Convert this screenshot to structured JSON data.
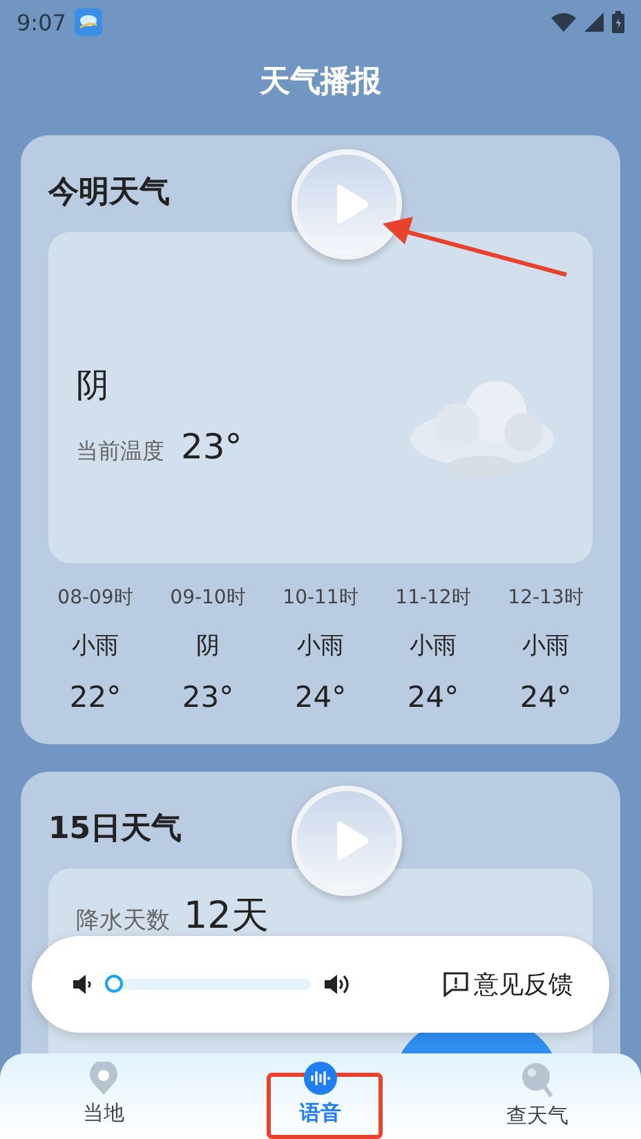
{
  "status_bar": {
    "time": "9:07"
  },
  "title": "天气播报",
  "cards": [
    {
      "kind": "today",
      "title": "今明天气",
      "condition": "阴",
      "temp_label": "当前温度",
      "temp": "23°",
      "hours": [
        {
          "time": "08-09时",
          "weather": "小雨",
          "temp": "22°"
        },
        {
          "time": "09-10时",
          "weather": "阴",
          "temp": "23°"
        },
        {
          "time": "10-11时",
          "weather": "小雨",
          "temp": "24°"
        },
        {
          "time": "11-12时",
          "weather": "小雨",
          "temp": "24°"
        },
        {
          "time": "12-13时",
          "weather": "小雨",
          "temp": "24°"
        }
      ]
    },
    {
      "kind": "fifteen",
      "title": "15日天气",
      "rain_label": "降水天数",
      "rain_value": "12天"
    }
  ],
  "player": {
    "level": 0.0,
    "feedback": "意见反馈"
  },
  "nav": [
    {
      "kind": "pin",
      "label": "当地",
      "selected": false
    },
    {
      "kind": "voice",
      "label": "语音",
      "selected": true
    },
    {
      "kind": "search",
      "label": "查天气",
      "selected": false
    }
  ]
}
